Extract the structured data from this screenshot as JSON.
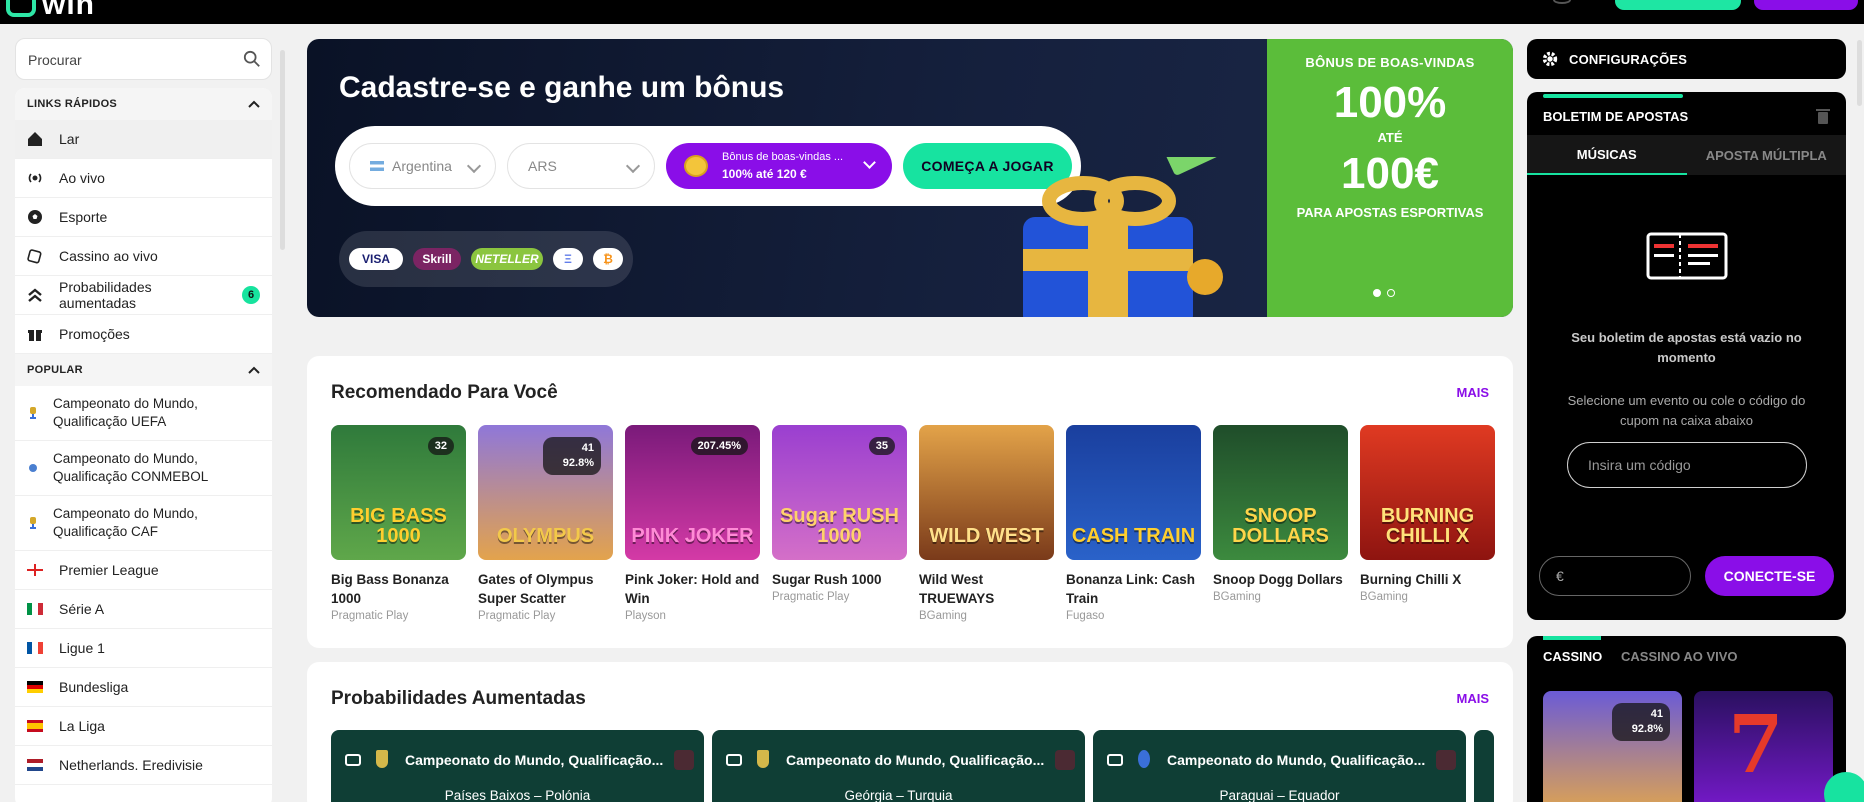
{
  "brand": {
    "name": "win"
  },
  "sidebar": {
    "search_label": "Procurar",
    "quick_links_title": "LINKS RÁPIDOS",
    "quick_links": [
      {
        "label": "Lar",
        "icon": "home-icon"
      },
      {
        "label": "Ao vivo",
        "icon": "live-icon"
      },
      {
        "label": "Esporte",
        "icon": "soccer-ball-icon"
      },
      {
        "label": "Cassino ao vivo",
        "icon": "chip-icon"
      },
      {
        "label": "Probabilidades aumentadas",
        "icon": "boost-icon",
        "badge": "6"
      },
      {
        "label": "Promoções",
        "icon": "gift-icon"
      }
    ],
    "popular_title": "POPULAR",
    "popular": [
      {
        "label_line1": "Campeonato do Mundo,",
        "label_line2": "Qualificação UEFA"
      },
      {
        "label_line1": "Campeonato do Mundo,",
        "label_line2": "Qualificação CONMEBOL"
      },
      {
        "label_line1": "Campeonato do Mundo,",
        "label_line2": "Qualificação CAF"
      },
      {
        "label": "Premier League"
      },
      {
        "label": "Série A"
      },
      {
        "label": "Ligue 1"
      },
      {
        "label": "Bundesliga"
      },
      {
        "label": "La Liga"
      },
      {
        "label": "Netherlands. Eredivisie"
      }
    ]
  },
  "hero": {
    "title": "Cadastre-se e ganhe um bônus",
    "country": "Argentina",
    "currency": "ARS",
    "bonus_line1": "Bônus de boas-vindas ...",
    "bonus_line2": "100% até 120 €",
    "cta": "COMEÇA A JOGAR",
    "payments": [
      "VISA",
      "Skrill",
      "NETELLER",
      "Ξ",
      "₿"
    ],
    "promo": {
      "line1": "BÔNUS DE BOAS-VINDAS",
      "line2": "100%",
      "line3": "ATÉ",
      "line4": "100€",
      "line5": "PARA APOSTAS ESPORTIVAS"
    }
  },
  "recommended": {
    "title": "Recomendado Para Você",
    "more": "MAIS",
    "games": [
      {
        "name": "Big Bass Bonanza 1000",
        "provider": "Pragmatic Play",
        "art": "BIG BASS 1000",
        "tag": "32",
        "bg": "#3f8f4a"
      },
      {
        "name": "Gates of Olympus Super Scatter",
        "provider": "Pragmatic Play",
        "art": "OLYMPUS",
        "tag_a": "41",
        "tag_b": "92.8%",
        "bg": "#a77fd6"
      },
      {
        "name": "Pink Joker: Hold and Win",
        "provider": "Playson",
        "art": "PINK JOKER",
        "tag": "207.45%",
        "bg": "#b62a9e"
      },
      {
        "name": "Sugar Rush 1000",
        "provider": "Pragmatic Play",
        "art": "Sugar RUSH 1000",
        "tag": "35",
        "bg": "#b45ad8"
      },
      {
        "name": "Wild West TRUEWAYS",
        "provider": "BGaming",
        "art": "WILD WEST",
        "bg": "#c6762c"
      },
      {
        "name": "Bonanza Link: Cash Train",
        "provider": "Fugaso",
        "art": "CASH TRAIN",
        "bg": "#1e4fb0"
      },
      {
        "name": "Snoop Dogg Dollars",
        "provider": "BGaming",
        "art": "SNOOP DOLLARS",
        "bg": "#2d6b34"
      },
      {
        "name": "Burning Chilli X",
        "provider": "BGaming",
        "art": "BURNING CHILLI X",
        "bg": "#b0221a"
      }
    ]
  },
  "boosted": {
    "title": "Probabilidades Aumentadas",
    "more": "MAIS",
    "events": [
      {
        "competition": "Campeonato do Mundo, Qualificação...",
        "match": "Países Baixos – Polónia"
      },
      {
        "competition": "Campeonato do Mundo, Qualificação...",
        "match": "Geórgia – Turquia"
      },
      {
        "competition": "Campeonato do Mundo, Qualificação...",
        "match": "Paraguai – Equador"
      }
    ]
  },
  "right": {
    "settings": "CONFIGURAÇÕES",
    "betslip_title": "BOLETIM DE APOSTAS",
    "tab_single": "MÚSICAS",
    "tab_multi": "APOSTA MÚLTIPLA",
    "empty_title": "Seu boletim de apostas está vazio no momento",
    "empty_hint": "Selecione um evento ou cole o código do cupom na caixa abaixo",
    "code_placeholder": "Insira um código",
    "amount_placeholder": "€",
    "connect": "CONECTE-SE",
    "casino_tab": "CASSINO",
    "live_casino_tab": "CASSINO AO VIVO",
    "casino_game_tag_a": "41",
    "casino_game_tag_b": "92.8%"
  },
  "colors": {
    "accent_green": "#17e3a0",
    "accent_purple": "#8a0ee8",
    "promo_green": "#5bbd3a"
  }
}
